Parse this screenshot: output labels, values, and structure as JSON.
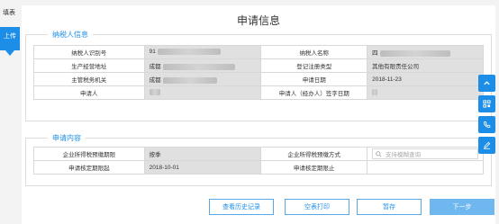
{
  "sidebar": {
    "fill_label": "填表",
    "upload_label": "上传"
  },
  "page": {
    "title": "申请信息"
  },
  "taxpayer": {
    "legend": "纳税人信息",
    "rows": [
      {
        "l1": "纳税人识别号",
        "v1": "91",
        "l2": "纳税人名称",
        "v2": "四"
      },
      {
        "l1": "生产经营地址",
        "v1": "成都",
        "l2": "登记注册类型",
        "v2": "其他有限责任公司"
      },
      {
        "l1": "主管税务机关",
        "v1": "成都",
        "l2": "申请日期",
        "v2": "2018-11-23"
      },
      {
        "l1": "申请人",
        "v1": "",
        "l2": "申请人（经办人）签字日期",
        "v2": ""
      }
    ]
  },
  "application": {
    "legend": "申请内容",
    "rows": [
      {
        "l1": "企业所得税预缴期限",
        "v1": "按季",
        "l2": "企业所得税预缴方式",
        "search_placeholder": "支持模糊查询"
      },
      {
        "l1": "申请核定期限起",
        "v1": "2018-10-01",
        "l2": "申请核定期限止",
        "v2": ""
      }
    ]
  },
  "buttons": {
    "history": "查看历史记录",
    "blank_print": "空表打印",
    "save": "暂存",
    "next": "下一步"
  },
  "float_icons": [
    "chevron-up-icon",
    "qrcode-icon",
    "phone-icon",
    "edit-icon"
  ],
  "colors": {
    "accent": "#1d8ee8",
    "readonly_cell": "#e0e0e0"
  }
}
